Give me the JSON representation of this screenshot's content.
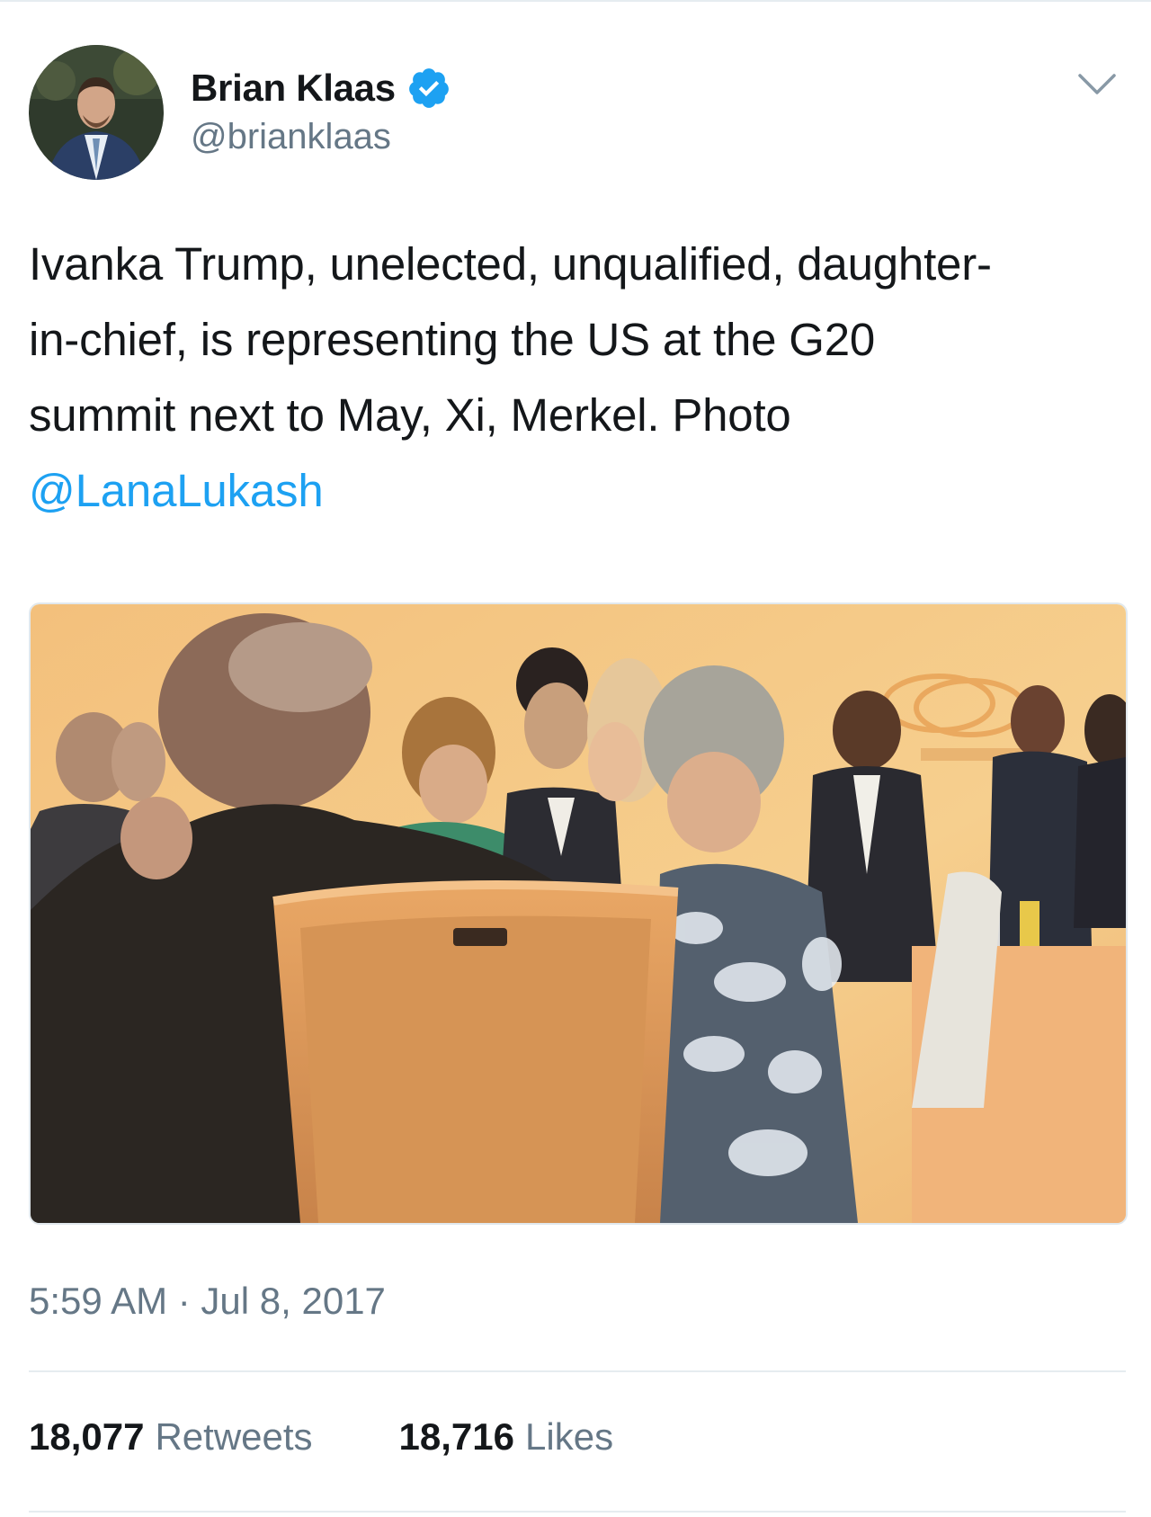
{
  "author": {
    "display_name": "Brian Klaas",
    "handle": "@brianklaas",
    "verified": true,
    "verified_icon": "verified-badge-icon",
    "avatar_icon": "avatar"
  },
  "tweet": {
    "text_lines": [
      "Ivanka Trump, unelected, unqualified, daughter-",
      "in-chief, is representing the US at the G20",
      "summit next to May, Xi, Merkel. Photo"
    ],
    "mention": "@LanaLukash",
    "timestamp": "5:59 AM · Jul 8, 2017"
  },
  "stats": {
    "retweets_count": "18,077",
    "retweets_label": "Retweets",
    "likes_count": "18,716",
    "likes_label": "Likes"
  },
  "menu_icon": "chevron-down-icon",
  "colors": {
    "link": "#1da1f2",
    "verified": "#1da1f2",
    "muted": "#657786",
    "text": "#14171a",
    "divider": "#e6ecf0"
  }
}
